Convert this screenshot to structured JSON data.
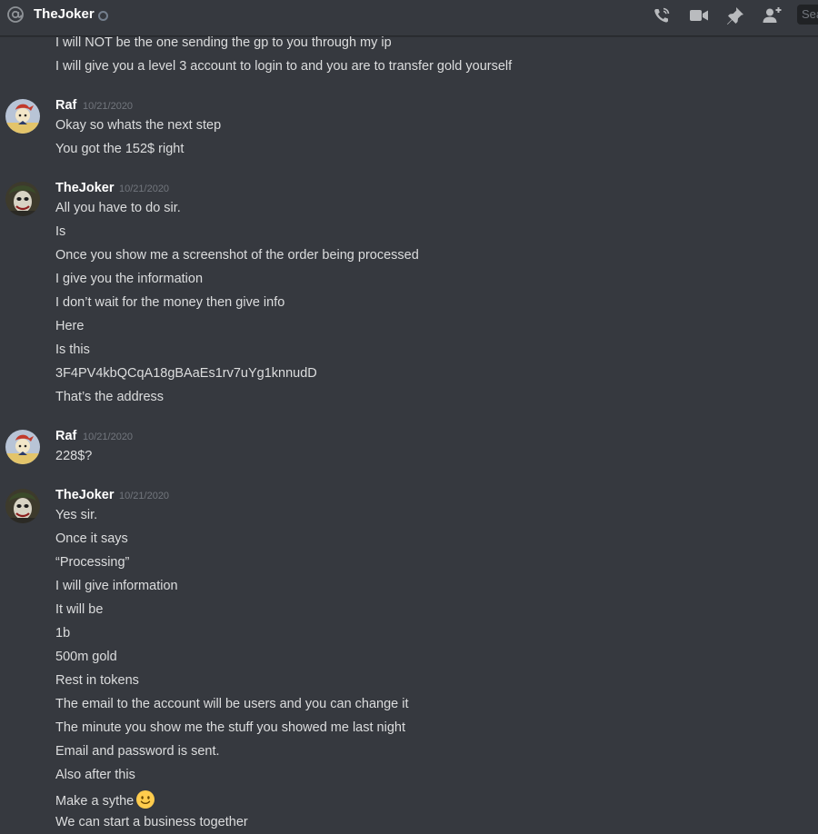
{
  "header": {
    "channel_name": "TheJoker",
    "search_placeholder": "Sea"
  },
  "top_messages": [
    "I will NOT be the one sending the gp to you through my ip",
    "I will give you a level 3 account to login to and you are to transfer gold yourself"
  ],
  "groups": [
    {
      "author": "Raf",
      "timestamp": "10/21/2020",
      "lines": [
        "Okay so whats the next step",
        "You got the 152$ right"
      ]
    },
    {
      "author": "TheJoker",
      "timestamp": "10/21/2020",
      "lines": [
        "All you have to do sir.",
        "Is",
        "Once you show me a screenshot of the order being processed",
        "I give you the information",
        "I don’t wait for the money then give info",
        "Here",
        "Is this",
        "3F4PV4kbQCqA18gBAaEs1rv7uYg1knnudD",
        "That’s the address"
      ]
    },
    {
      "author": "Raf",
      "timestamp": "10/21/2020",
      "lines": [
        "228$?"
      ]
    },
    {
      "author": "TheJoker",
      "timestamp": "10/21/2020",
      "lines": [
        "Yes sir.",
        "Once it says",
        "“Processing”",
        "I will give information",
        "It will be",
        "1b",
        "500m gold",
        "Rest in tokens",
        "The email to the account will be users and you can change it",
        "The minute you show me the stuff you showed me last night",
        "Email and password is sent.",
        "Also after this",
        "Make a sythe",
        "We can start a business together"
      ]
    }
  ],
  "icons": {
    "at": "at-icon",
    "status": "offline-status-icon",
    "call": "phone-call-icon",
    "video": "video-call-icon",
    "pin": "pin-icon",
    "add_friend": "add-friend-icon",
    "emoji": "slightly-smiling-face-emoji"
  }
}
